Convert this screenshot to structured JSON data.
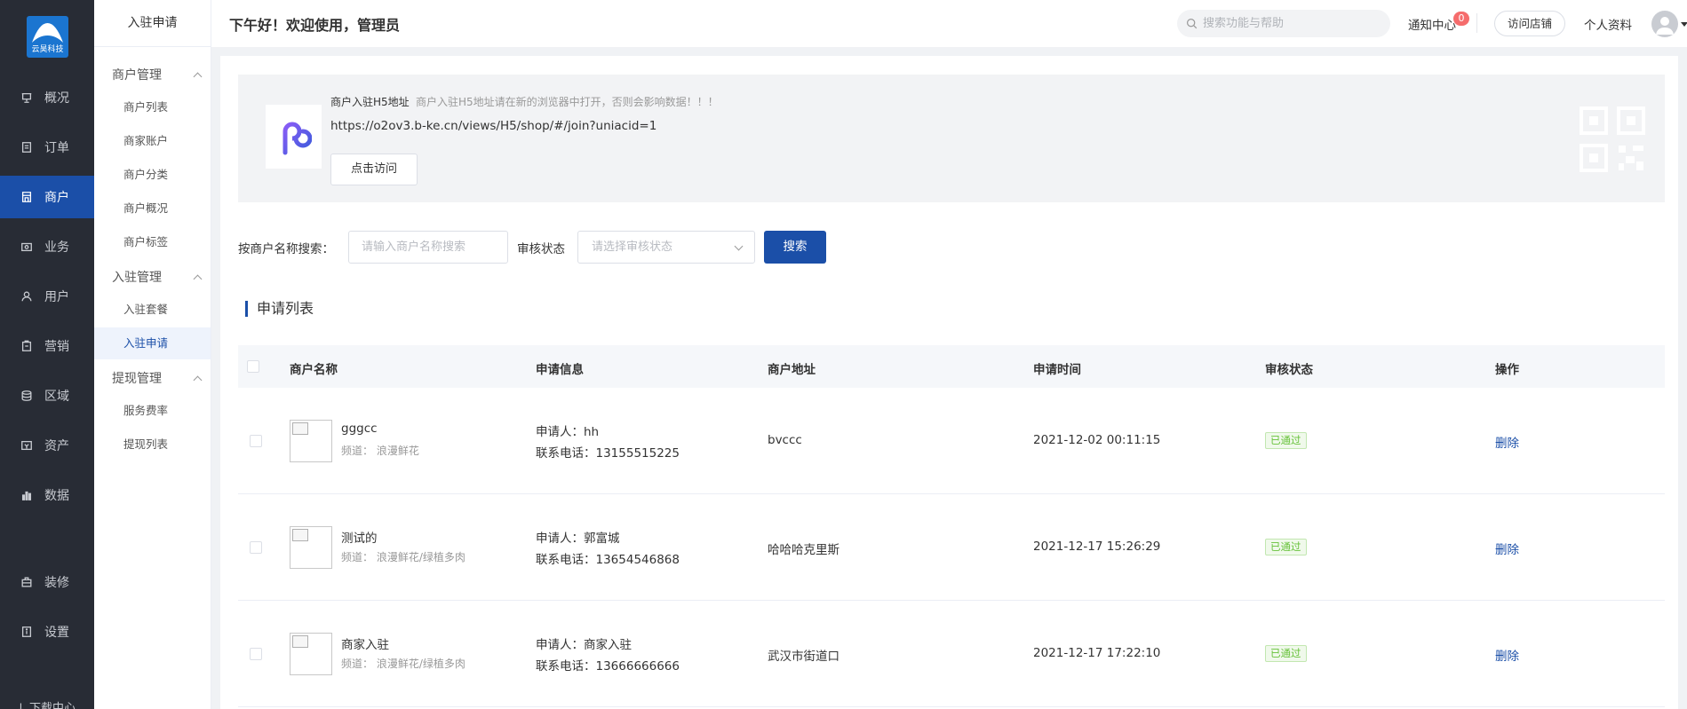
{
  "logo": {
    "text": "云昊科技"
  },
  "sidebar": {
    "items": [
      {
        "label": "概况",
        "icon": "overview-icon"
      },
      {
        "label": "订单",
        "icon": "order-icon"
      },
      {
        "label": "商户",
        "icon": "merchant-icon",
        "active": true
      },
      {
        "label": "业务",
        "icon": "business-icon"
      },
      {
        "label": "用户",
        "icon": "user-icon"
      },
      {
        "label": "营销",
        "icon": "marketing-icon"
      },
      {
        "label": "区域",
        "icon": "region-icon"
      },
      {
        "label": "资产",
        "icon": "asset-icon"
      },
      {
        "label": "数据",
        "icon": "data-icon"
      },
      {
        "label": "装修",
        "icon": "decorate-icon"
      },
      {
        "label": "设置",
        "icon": "settings-icon"
      }
    ],
    "bottom_label": "下载中心"
  },
  "subnav": {
    "title": "入驻申请",
    "groups": [
      {
        "title": "商户管理",
        "items": [
          "商户列表",
          "商家账户",
          "商户分类",
          "商户概况",
          "商户标签"
        ]
      },
      {
        "title": "入驻管理",
        "items": [
          "入驻套餐",
          "入驻申请"
        ]
      },
      {
        "title": "提现管理",
        "items": [
          "服务费率",
          "提现列表"
        ]
      }
    ]
  },
  "header": {
    "greeting": "下午好！欢迎使用，管理员",
    "search_placeholder": "搜索功能与帮助",
    "notify_label": "通知中心",
    "notify_count": "0",
    "visit_store": "访问店铺",
    "profile": "个人资料"
  },
  "banner": {
    "title": "商户入驻H5地址",
    "tip": "商户入驻H5地址请在新的浏览器中打开，否则会影响数据！！！",
    "url": "https://o2ov3.b-ke.cn/views/H5/shop/#/join?uniacid=1",
    "button": "点击访问"
  },
  "filter": {
    "name_label": "按商户名称搜索：",
    "name_placeholder": "请输入商户名称搜索",
    "status_label": "审核状态",
    "status_placeholder": "请选择审核状态",
    "search_button": "搜索"
  },
  "section_title": "申请列表",
  "table": {
    "columns": [
      "商户名称",
      "申请信息",
      "商户地址",
      "申请时间",
      "审核状态",
      "操作"
    ],
    "rows": [
      {
        "name": "gggcc",
        "channel": "频道： 浪漫鲜花",
        "applicant": "申请人：hh",
        "phone": "联系电话：13155515225",
        "address": "bvccc",
        "time": "2021-12-02 00:11:15",
        "status": "已通过",
        "action": "删除"
      },
      {
        "name": "测试的",
        "channel": "频道： 浪漫鲜花/绿植多肉",
        "applicant": "申请人：郭富城",
        "phone": "联系电话：13654546868",
        "address": "哈哈哈克里斯",
        "time": "2021-12-17 15:26:29",
        "status": "已通过",
        "action": "删除"
      },
      {
        "name": "商家入驻",
        "channel": "频道： 浪漫鲜花/绿植多肉",
        "applicant": "申请人：商家入驻",
        "phone": "联系电话：13666666666",
        "address": "武汉市街道口",
        "time": "2021-12-17 17:22:10",
        "status": "已通过",
        "action": "删除"
      }
    ]
  },
  "colors": {
    "sidebar_bg": "#282c35",
    "accent": "#1b4fa8",
    "success": "#67c23a"
  }
}
